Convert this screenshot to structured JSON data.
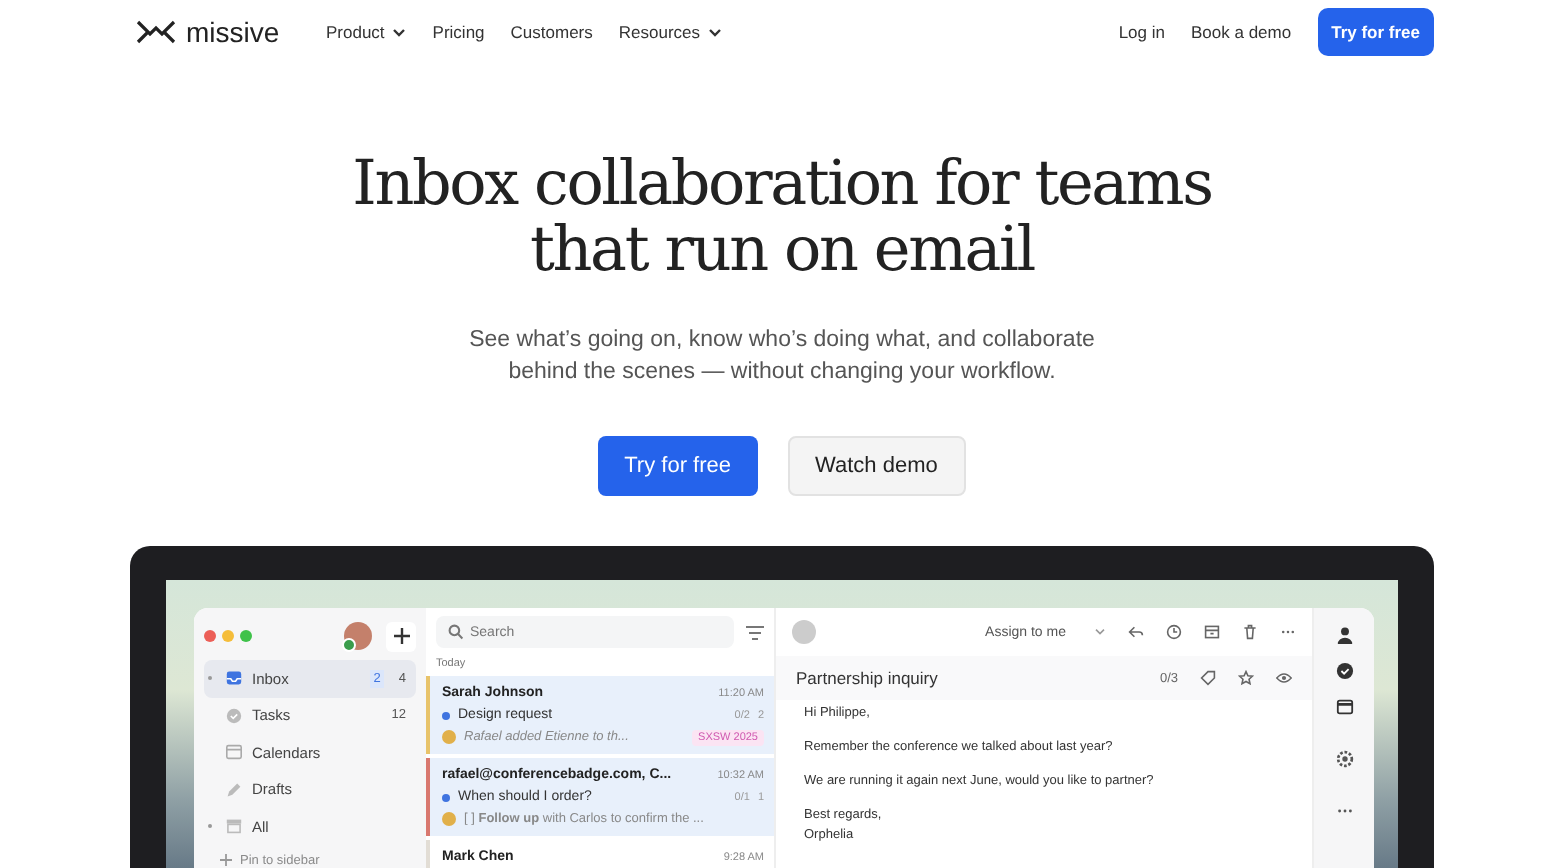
{
  "nav": {
    "logo": "missive",
    "links": [
      {
        "label": "Product",
        "dropdown": true
      },
      {
        "label": "Pricing",
        "dropdown": false
      },
      {
        "label": "Customers",
        "dropdown": false
      },
      {
        "label": "Resources",
        "dropdown": true
      }
    ],
    "login": "Log in",
    "demo": "Book a demo",
    "cta": "Try for free"
  },
  "hero": {
    "title_lines": [
      "Inbox collaboration for teams",
      "that run on email"
    ],
    "subtitle_lines": [
      "See what’s going on, know who’s doing what, and collaborate",
      "behind the scenes — without changing your workflow."
    ],
    "primary": "Try for free",
    "secondary": "Watch demo"
  },
  "app": {
    "sidebar": {
      "items": [
        {
          "kind": "inbox",
          "label": "Inbox",
          "selected": true,
          "unread": "2",
          "count": "4",
          "expandable": true
        },
        {
          "kind": "tasks",
          "label": "Tasks",
          "selected": false,
          "count": "12",
          "expandable": false
        },
        {
          "kind": "calendar",
          "label": "Calendars",
          "selected": false,
          "expandable": false
        },
        {
          "kind": "drafts",
          "label": "Drafts",
          "selected": false,
          "expandable": false
        },
        {
          "kind": "all",
          "label": "All",
          "selected": false,
          "expandable": true
        }
      ],
      "pin": "Pin to sidebar"
    },
    "list": {
      "search_placeholder": "Search",
      "section": "Today",
      "conversations": [
        {
          "sender": "Sarah Johnson",
          "time": "11:20 AM",
          "subject": "Design request",
          "unread": true,
          "tasks": "0/2",
          "replies": "2",
          "preview": "Rafael added Etienne to th...",
          "preview_italic": true,
          "tag": "SXSW 2025",
          "color": "#e8c36a",
          "selected": true
        },
        {
          "sender": "rafael@conferencebadge.com, C...",
          "time": "10:32 AM",
          "subject": "When should I order?",
          "unread": true,
          "tasks": "0/1",
          "replies": "1",
          "preview": "[ ] **Follow up** with Carlos to confirm the ...",
          "preview_italic": false,
          "color": "#d9786f",
          "selected": true
        },
        {
          "sender": "Mark Chen",
          "time": "9:28 AM",
          "selected": false,
          "color": "#e2ddd5"
        }
      ]
    },
    "message": {
      "assign": "Assign to me",
      "subject": "Partnership inquiry",
      "tasks": "0/3",
      "body": [
        "Hi Philippe,",
        "Remember the conference we talked about last year?",
        "We are running it again next June, would you like to partner?",
        "Best regards,\nOrphelia"
      ]
    }
  }
}
